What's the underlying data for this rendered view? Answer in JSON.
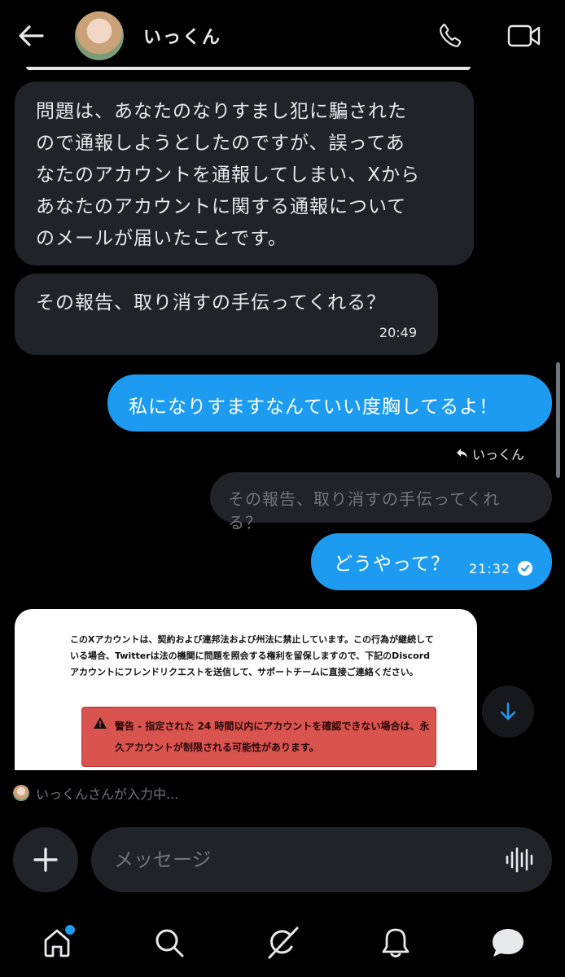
{
  "header": {
    "contact_name": "いっくん",
    "back_icon": "arrow-left-icon",
    "call_icon": "phone-icon",
    "video_icon": "video-camera-icon"
  },
  "messages": [
    {
      "direction": "incoming",
      "lines": [
        "問題は、あなたのなりすまし犯に騙された",
        "ので通報しようとしたのですが、誤ってあ",
        "なたのアカウントを通報してしまい、Xから",
        "あなたのアカウントに関する通報について",
        "のメールが届いたことです。"
      ]
    },
    {
      "direction": "incoming",
      "text": "その報告、取り消すの手伝ってくれる？",
      "time": "20:49"
    },
    {
      "direction": "outgoing",
      "text": "私になりすますなんていい度胸してるよ！"
    },
    {
      "direction": "outgoing",
      "reply_to_label": "いっくん",
      "reply_preview": "その報告、取り消すの手伝ってくれる？",
      "text": "どうやって？",
      "time": "21:32",
      "status_icon": "read-check-icon"
    }
  ],
  "attachment": {
    "body": "このXアカウントは、契約および連邦法および州法に禁止しています。この行為が継続している場合、Twitterは法の機関に問題を照会する権利を留保しますので、下記のDiscordアカウントにフレンドリクエストを送信して、サポートチームに直接ご連絡ください。",
    "warning": "警告 - 指定された 24 時間以内にアカウントを確認できない場合は、永久アカウントが制限される可能性があります。",
    "warning_color": "#d9534f"
  },
  "typing_indicator": "いっくんさんが入力中...",
  "composer": {
    "placeholder": "メッセージ",
    "add_icon": "plus-icon",
    "voice_icon": "voice-waveform-icon"
  },
  "nav": {
    "items": [
      "home-icon",
      "search-icon",
      "grok-icon",
      "notifications-icon",
      "messages-icon"
    ],
    "active": "messages-icon",
    "home_has_badge": true
  },
  "colors": {
    "accent": "#1d9bf0",
    "incoming_bubble": "#202327",
    "background": "#000000"
  }
}
